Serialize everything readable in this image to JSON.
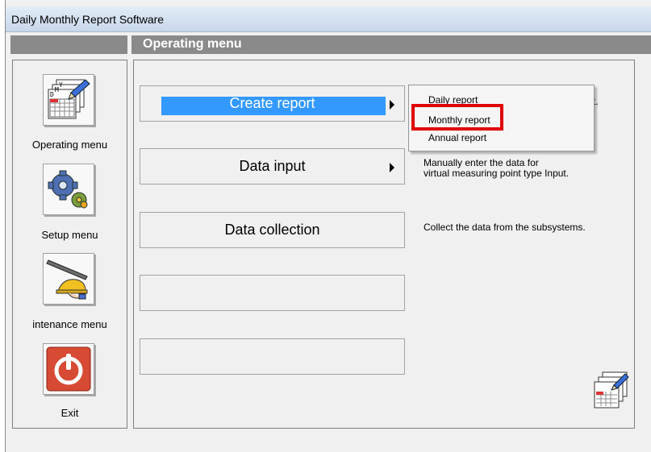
{
  "window": {
    "title": "Daily Monthly Report Software"
  },
  "header": {
    "section_title": "Operating menu"
  },
  "sidebar": {
    "items": [
      {
        "label": "Operating menu",
        "icon": "calendar-report-icon"
      },
      {
        "label": "Setup menu",
        "icon": "gears-icon"
      },
      {
        "label": "intenance menu",
        "icon": "maintenance-tools-icon"
      },
      {
        "label": "Exit",
        "icon": "power-icon"
      }
    ]
  },
  "main": {
    "buttons": [
      {
        "label": "Create report",
        "has_submenu": true,
        "selected": true
      },
      {
        "label": "Data input",
        "has_submenu": true
      },
      {
        "label": "Data collection",
        "has_submenu": false
      },
      {
        "label": ""
      },
      {
        "label": ""
      }
    ],
    "descriptions": {
      "data_input_line1": "Manually enter the data for",
      "data_input_line2": "virtual measuring point type Input.",
      "data_collection": "Collect the data from the subsystems.",
      "create_report_tail": "t."
    },
    "submenu": {
      "items": [
        "Daily report",
        "Monthly report",
        "Annual report"
      ],
      "highlighted": "Monthly report"
    },
    "corner_icon": "calendar-report-icon"
  },
  "colors": {
    "selection": "#3399ff",
    "highlight_box": "#e00000",
    "header_strip": "#8a8a8a"
  }
}
